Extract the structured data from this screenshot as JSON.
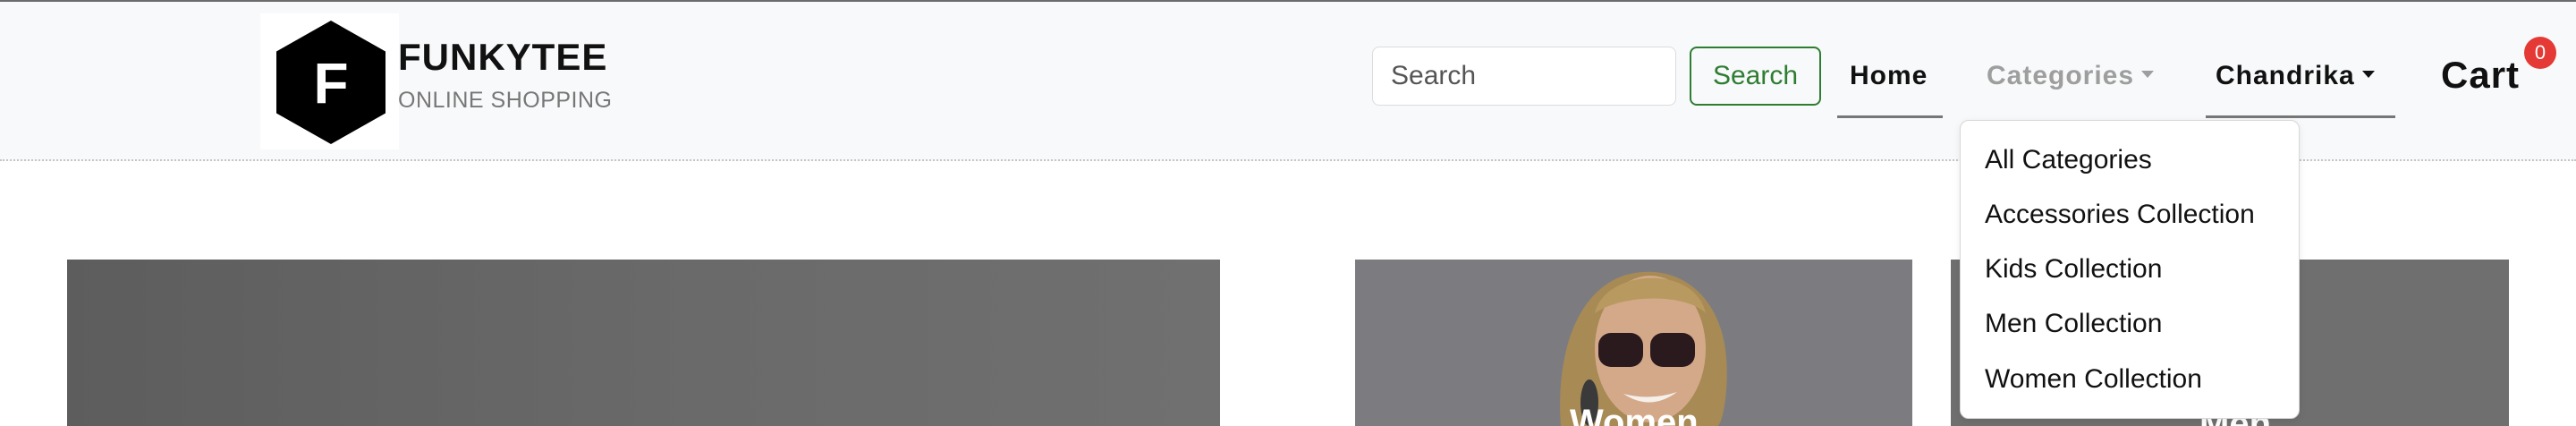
{
  "brand": {
    "initial": "F",
    "name": "FUNKYTEE",
    "tagline": "ONLINE SHOPPING"
  },
  "search": {
    "placeholder": "Search",
    "button_label": "Search"
  },
  "nav": {
    "home": "Home",
    "categories": "Categories",
    "user": "Chandrika",
    "cart": "Cart",
    "cart_count": "0"
  },
  "categories_menu": {
    "items": [
      "All Categories",
      "Accessories Collection",
      "Kids Collection",
      "Men Collection",
      "Women Collection"
    ]
  },
  "cards": {
    "women_title": "Women",
    "men_title": "Men"
  },
  "colors": {
    "navbar_bg": "#f8f9fa",
    "search_button": "#2e7d32",
    "cart_badge": "#e53935",
    "muted_link": "#9e9e9e"
  }
}
